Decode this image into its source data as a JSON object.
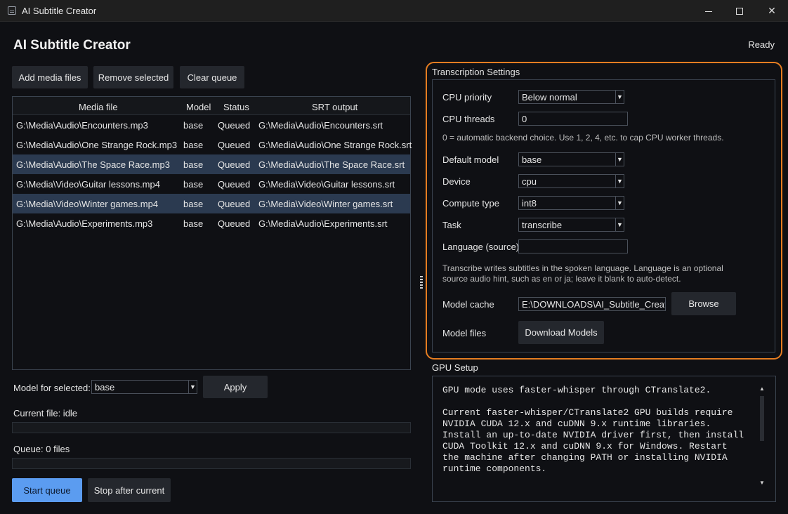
{
  "window": {
    "title": "AI Subtitle Creator"
  },
  "header": {
    "title": "AI Subtitle Creator",
    "status": "Ready"
  },
  "toolbar": {
    "add_label": "Add media files",
    "remove_label": "Remove selected",
    "clear_label": "Clear queue"
  },
  "table": {
    "columns": [
      "Media file",
      "Model",
      "Status",
      "SRT output"
    ],
    "rows": [
      {
        "file": "G:\\Media\\Audio\\Encounters.mp3",
        "model": "base",
        "status": "Queued",
        "srt": "G:\\Media\\Audio\\Encounters.srt",
        "selected": false
      },
      {
        "file": "G:\\Media\\Audio\\One Strange Rock.mp3",
        "model": "base",
        "status": "Queued",
        "srt": "G:\\Media\\Audio\\One Strange Rock.srt",
        "selected": false
      },
      {
        "file": "G:\\Media\\Audio\\The Space Race.mp3",
        "model": "base",
        "status": "Queued",
        "srt": "G:\\Media\\Audio\\The Space Race.srt",
        "selected": true
      },
      {
        "file": "G:\\Media\\Video\\Guitar lessons.mp4",
        "model": "base",
        "status": "Queued",
        "srt": "G:\\Media\\Video\\Guitar lessons.srt",
        "selected": false
      },
      {
        "file": "G:\\Media\\Video\\Winter games.mp4",
        "model": "base",
        "status": "Queued",
        "srt": "G:\\Media\\Video\\Winter games.srt",
        "selected": true
      },
      {
        "file": "G:\\Media\\Audio\\Experiments.mp3",
        "model": "base",
        "status": "Queued",
        "srt": "G:\\Media\\Audio\\Experiments.srt",
        "selected": false
      }
    ]
  },
  "model_selected": {
    "label": "Model for selected:",
    "value": "base",
    "apply_label": "Apply"
  },
  "progress": {
    "current_label": "Current file: idle",
    "current_value": 0,
    "queue_label": "Queue: 0 files",
    "queue_value": 0
  },
  "actions": {
    "start_label": "Start queue",
    "stop_label": "Stop after current"
  },
  "transcription": {
    "title": "Transcription Settings",
    "cpu_priority_label": "CPU priority",
    "cpu_priority_value": "Below normal",
    "cpu_threads_label": "CPU threads",
    "cpu_threads_value": "0",
    "cpu_threads_hint": "0 = automatic backend choice. Use 1, 2, 4, etc. to cap CPU worker threads.",
    "default_model_label": "Default model",
    "default_model_value": "base",
    "device_label": "Device",
    "device_value": "cpu",
    "compute_type_label": "Compute type",
    "compute_type_value": "int8",
    "task_label": "Task",
    "task_value": "transcribe",
    "language_label": "Language (source)",
    "language_value": "",
    "task_hint_line1": "Transcribe writes subtitles in the spoken language. Language is an optional",
    "task_hint_line2": "source audio hint, such as en or ja; leave it blank to auto-detect.",
    "model_cache_label": "Model cache",
    "model_cache_value": "E:\\DOWNLOADS\\AI_Subtitle_Creator_G",
    "browse_label": "Browse",
    "model_files_label": "Model files",
    "download_label": "Download Models"
  },
  "gpu": {
    "title": "GPU Setup",
    "text": "GPU mode uses faster-whisper through CTranslate2.\n\nCurrent faster-whisper/CTranslate2 GPU builds require\nNVIDIA CUDA 12.x and cuDNN 9.x runtime libraries.\nInstall an up-to-date NVIDIA driver first, then install\nCUDA Toolkit 12.x and cuDNN 9.x for Windows. Restart\nthe machine after changing PATH or installing NVIDIA\nruntime components."
  },
  "colors": {
    "accent": "#5b9cf0",
    "highlight_frame": "#e57d21",
    "selected_row": "#2b3a50"
  }
}
